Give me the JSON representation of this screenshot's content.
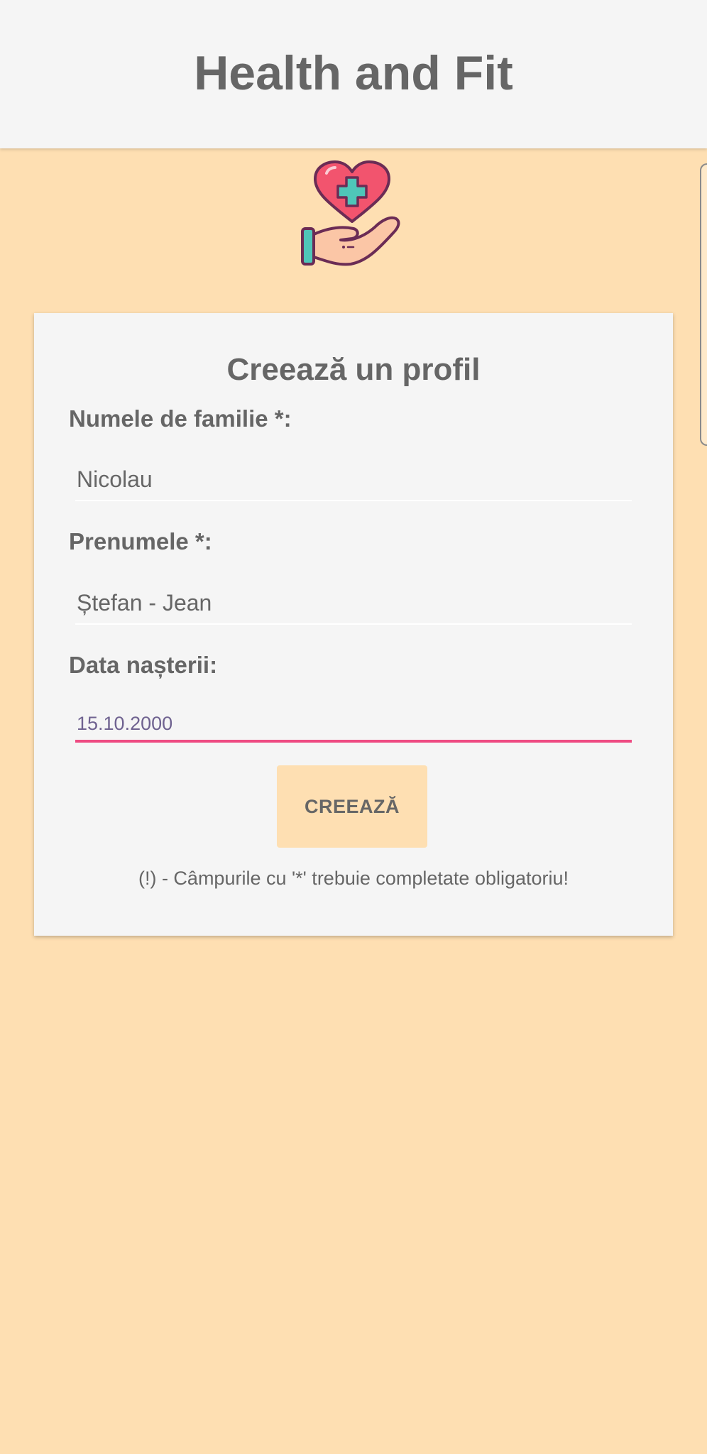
{
  "app": {
    "title": "Health and Fit"
  },
  "logo": {
    "icon": "heart-hand-medical-icon"
  },
  "form": {
    "title": "Creează un profil",
    "fields": [
      {
        "label": "Numele de familie *:",
        "value": "Nicolau"
      },
      {
        "label": "Prenumele *:",
        "value": "Ștefan - Jean"
      },
      {
        "label": "Data nașterii:",
        "value": "15.10.2000"
      }
    ],
    "submit_label": "CREEAZĂ",
    "required_note": "(!) - Câmpurile cu '*' trebuie completate obligatoriu!"
  },
  "colors": {
    "background": "#FEDFB2",
    "app_bar": "#F5F5F5",
    "card": "#F5F5F5",
    "text": "#666666",
    "accent": "#EE4B82",
    "button": "#FEDFB2"
  }
}
